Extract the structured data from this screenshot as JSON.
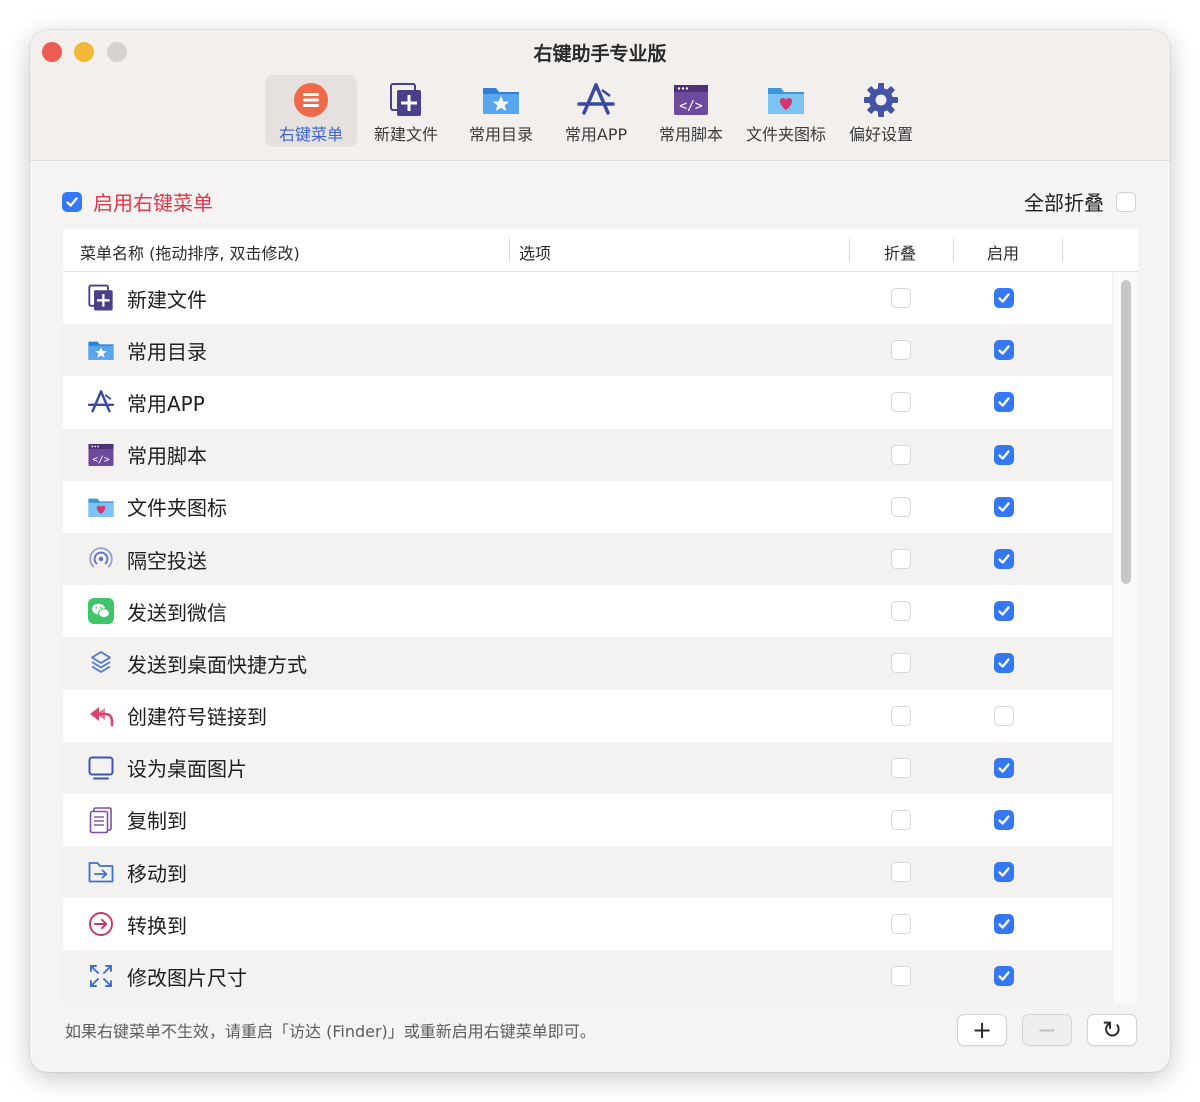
{
  "window": {
    "title": "右键助手专业版",
    "accent_color": "#3478f6",
    "warning_color": "#e0374b"
  },
  "toolbar": {
    "items": [
      {
        "label": "右键菜单",
        "icon": "menu-list-icon",
        "active": true
      },
      {
        "label": "新建文件",
        "icon": "new-file-icon",
        "active": false
      },
      {
        "label": "常用目录",
        "icon": "star-folder-icon",
        "active": false
      },
      {
        "label": "常用APP",
        "icon": "app-store-icon",
        "active": false
      },
      {
        "label": "常用脚本",
        "icon": "script-window-icon",
        "active": false
      },
      {
        "label": "文件夹图标",
        "icon": "heart-folder-icon",
        "active": false
      },
      {
        "label": "偏好设置",
        "icon": "gear-icon",
        "active": false
      }
    ]
  },
  "enable_menu": {
    "label": "启用右键菜单",
    "checked": true
  },
  "collapse_all": {
    "label": "全部折叠",
    "checked": false
  },
  "table": {
    "columns": [
      "菜单名称 (拖动排序, 双击修改)",
      "选项",
      "折叠",
      "启用"
    ],
    "rows": [
      {
        "name": "新建文件",
        "icon": "new-file-icon",
        "fold": false,
        "enabled": true
      },
      {
        "name": "常用目录",
        "icon": "star-folder-icon",
        "fold": false,
        "enabled": true
      },
      {
        "name": "常用APP",
        "icon": "app-store-icon",
        "fold": false,
        "enabled": true
      },
      {
        "name": "常用脚本",
        "icon": "script-window-icon",
        "fold": false,
        "enabled": true
      },
      {
        "name": "文件夹图标",
        "icon": "heart-folder-icon",
        "fold": false,
        "enabled": true
      },
      {
        "name": "隔空投送",
        "icon": "airdrop-icon",
        "fold": false,
        "enabled": true
      },
      {
        "name": "发送到微信",
        "icon": "wechat-icon",
        "fold": false,
        "enabled": true
      },
      {
        "name": "发送到桌面快捷方式",
        "icon": "shortcut-icon",
        "fold": false,
        "enabled": true
      },
      {
        "name": "创建符号链接到",
        "icon": "symlink-arrow-icon",
        "fold": false,
        "enabled": false
      },
      {
        "name": "设为桌面图片",
        "icon": "monitor-icon",
        "fold": false,
        "enabled": true
      },
      {
        "name": "复制到",
        "icon": "copy-document-icon",
        "fold": false,
        "enabled": true
      },
      {
        "name": "移动到",
        "icon": "move-folder-icon",
        "fold": false,
        "enabled": true
      },
      {
        "name": "转换到",
        "icon": "convert-arrow-icon",
        "fold": false,
        "enabled": true
      },
      {
        "name": "修改图片尺寸",
        "icon": "resize-icon",
        "fold": false,
        "enabled": true
      }
    ]
  },
  "footer": {
    "hint": "如果右键菜单不生效，请重启「访达 (Finder)」或重新启用右键菜单即可。",
    "buttons": [
      {
        "symbol": "+",
        "icon": "plus-icon",
        "enabled": true
      },
      {
        "symbol": "−",
        "icon": "minus-icon",
        "enabled": false
      },
      {
        "symbol": "↻",
        "icon": "refresh-icon",
        "enabled": true
      }
    ]
  }
}
